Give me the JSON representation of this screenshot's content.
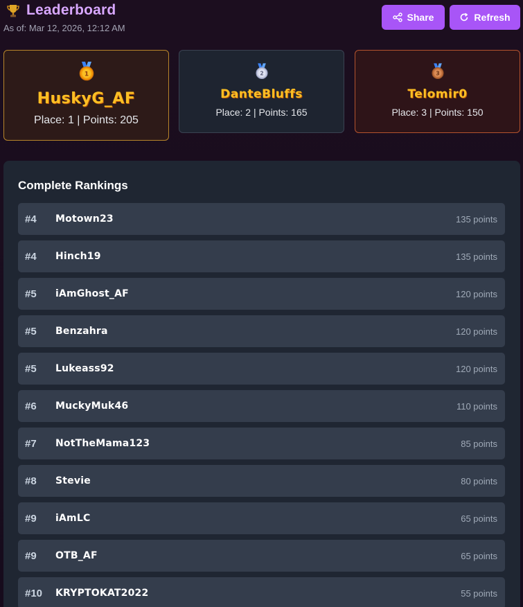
{
  "header": {
    "title": "Leaderboard",
    "as_of": "As of: Mar 12, 2026, 12:12 AM",
    "share_label": "Share",
    "refresh_label": "Refresh"
  },
  "podium": [
    {
      "medal_number": "1",
      "name": "HuskyG_AF",
      "stats": "Place: 1 | Points: 205"
    },
    {
      "medal_number": "2",
      "name": "DanteBluffs",
      "stats": "Place: 2 | Points: 165"
    },
    {
      "medal_number": "3",
      "name": "Telomir0",
      "stats": "Place: 3 | Points: 150"
    }
  ],
  "rankings": {
    "title": "Complete Rankings",
    "rows": [
      {
        "rank": "#4",
        "name": "Motown23",
        "points": "135 points"
      },
      {
        "rank": "#4",
        "name": "Hinch19",
        "points": "135 points"
      },
      {
        "rank": "#5",
        "name": "iAmGhost_AF",
        "points": "120 points"
      },
      {
        "rank": "#5",
        "name": "Benzahra",
        "points": "120 points"
      },
      {
        "rank": "#5",
        "name": "Lukeass92",
        "points": "120 points"
      },
      {
        "rank": "#6",
        "name": "MuckyMuk46",
        "points": "110 points"
      },
      {
        "rank": "#7",
        "name": "NotTheMama123",
        "points": "85 points"
      },
      {
        "rank": "#8",
        "name": "Stevie",
        "points": "80 points"
      },
      {
        "rank": "#9",
        "name": "iAmLC",
        "points": "65 points"
      },
      {
        "rank": "#9",
        "name": "OTB_AF",
        "points": "65 points"
      },
      {
        "rank": "#10",
        "name": "KRYPTOKAT2022",
        "points": "55 points"
      }
    ]
  },
  "icons": {
    "trophy": "trophy-icon",
    "share": "share-icon",
    "refresh": "refresh-icon",
    "medals": [
      "gold-medal-icon",
      "silver-medal-icon",
      "bronze-medal-icon"
    ]
  },
  "colors": {
    "accent": "#a855f7",
    "title": "#d8a7ff",
    "gold_text": "#fbbf24",
    "first_border": "#b8862a",
    "third_border": "#b4532e"
  }
}
